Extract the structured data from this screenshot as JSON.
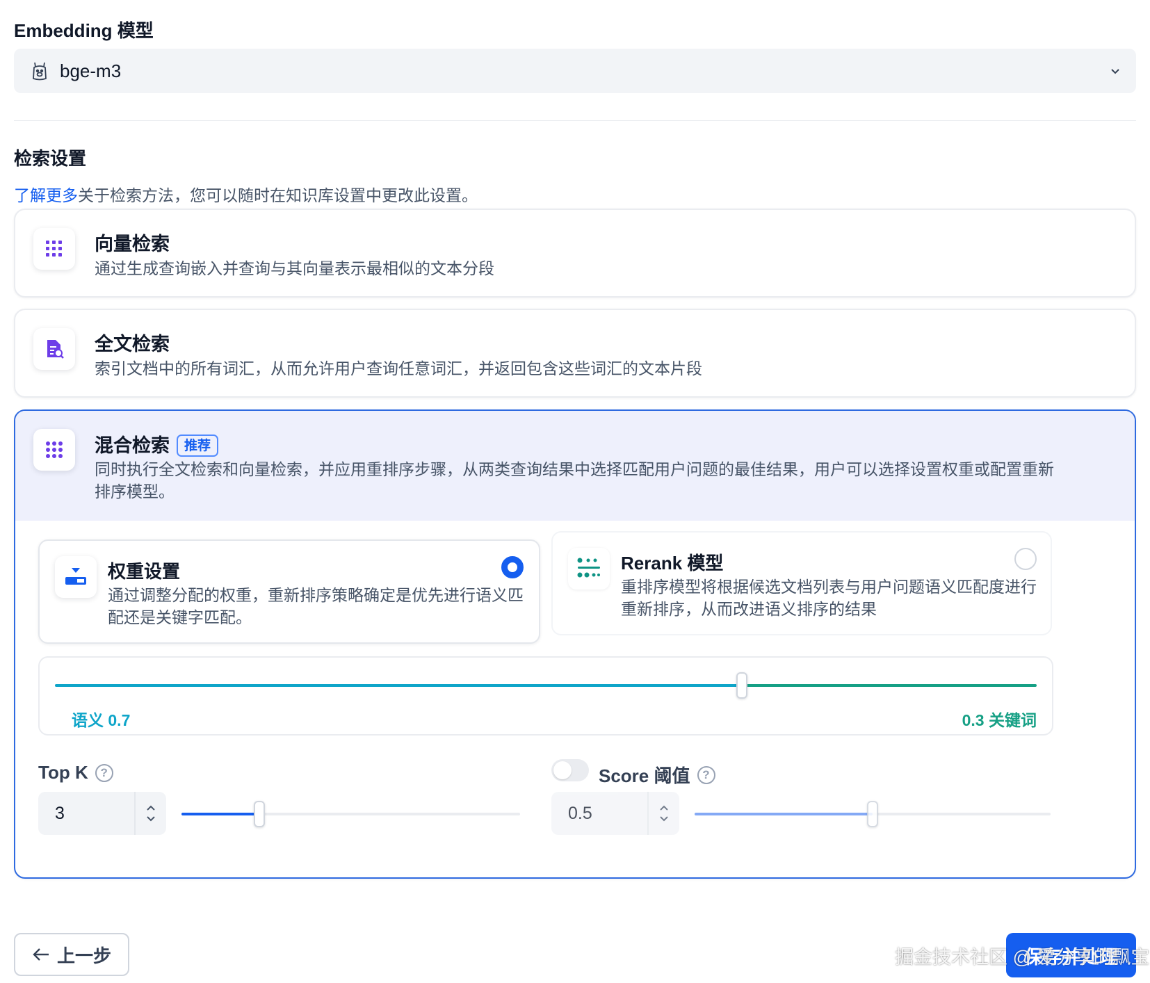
{
  "embedding": {
    "section_title": "Embedding 模型",
    "selected_model": "bge-m3",
    "icon": "llama-icon"
  },
  "retrieval": {
    "section_title": "检索设置",
    "learn_more": "了解更多",
    "description": "关于检索方法，您可以随时在知识库设置中更改此设置。",
    "options": [
      {
        "title": "向量检索",
        "description": "通过生成查询嵌入并查询与其向量表示最相似的文本分段",
        "icon": "grid-dots-icon"
      },
      {
        "title": "全文检索",
        "description": "索引文档中的所有词汇，从而允许用户查询任意词汇，并返回包含这些词汇的文本片段",
        "icon": "document-search-icon"
      },
      {
        "title": "混合检索",
        "badge": "推荐",
        "description_line1": "同时执行全文检索和向量检索，并应用重排序步骤，从两类查询结果中选择匹配用户问题的最佳结果，用户可以选择设置权重或配置重新",
        "description_line2": "排序模型。",
        "icon": "grid-dots-icon",
        "selected": true
      }
    ],
    "hybrid": {
      "weight_setting": {
        "title": "权重设置",
        "description_line1": "通过调整分配的权重，重新排序策略确定是优先进行语义匹",
        "description_line2": "配还是关键字匹配。",
        "selected": true,
        "icon": "weight-icon"
      },
      "rerank_model": {
        "title": "Rerank 模型",
        "description_line1": "重排序模型将根据候选文档列表与用户问题语义匹配度进行",
        "description_line2": "重新排序，从而改进语义排序的结果",
        "selected": false,
        "icon": "rerank-icon"
      },
      "weights": {
        "semantic_label": "语义 0.7",
        "keyword_label": "0.3 关键词",
        "semantic_value": 0.7,
        "keyword_value": 0.3
      },
      "top_k": {
        "label": "Top K",
        "value": "3",
        "slider_fraction": 0.23
      },
      "score_threshold": {
        "label": "Score 阈值",
        "value": "0.5",
        "enabled": false,
        "slider_fraction": 0.5
      }
    }
  },
  "footer": {
    "back_label": "上一步",
    "save_label": "保存并处理",
    "watermark": "掘金技术社区 @ 爱分享的飘宝"
  },
  "colors": {
    "primary": "#155eef",
    "semantic": "#0ea5c9",
    "keyword": "#16a085",
    "hybrid_border": "#2e6ae0",
    "hybrid_header_bg": "#eef0fc"
  }
}
